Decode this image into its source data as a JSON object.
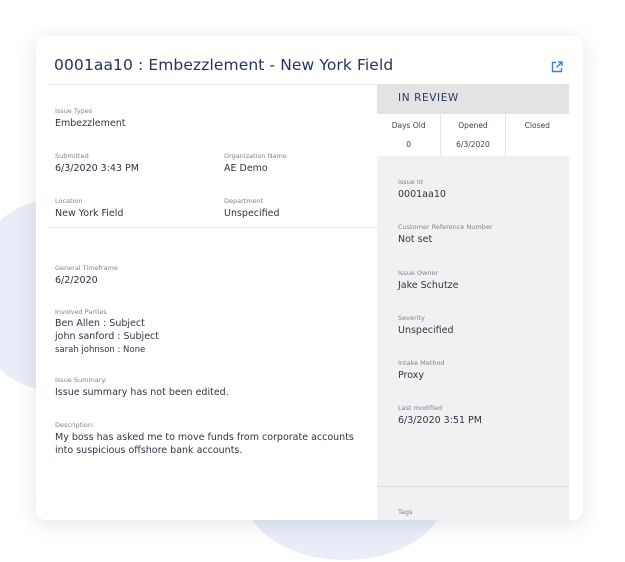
{
  "issue": {
    "title": "0001aa10 : Embezzlement - New York Field"
  },
  "fields": {
    "issue_types": {
      "label": "Issue Types",
      "value": "Embezzlement"
    },
    "submitted": {
      "label": "Submitted",
      "value": "6/3/2020 3:43 PM"
    },
    "organization_name": {
      "label": "Organization Name",
      "value": "AE Demo"
    },
    "location": {
      "label": "Location",
      "value": "New York Field"
    },
    "department": {
      "label": "Department",
      "value": "Unspecified"
    },
    "general_timeframe": {
      "label": "General Timeframe",
      "value": "6/2/2020"
    },
    "involved_parties": {
      "label": "Involved Parties",
      "items": [
        "Ben Allen : Subject",
        "john sanford : Subject",
        "sarah johnson : None"
      ]
    },
    "issue_summary": {
      "label": "Issue Summary:",
      "value": "Issue summary has not been edited."
    },
    "description": {
      "label": "Description:",
      "value": "My boss has asked me to move funds from corporate accounts into suspicious offshore bank accounts."
    }
  },
  "status": {
    "label": "IN REVIEW",
    "stats": [
      {
        "header": "Days Old",
        "value": "0"
      },
      {
        "header": "Opened",
        "value": "6/3/2020"
      },
      {
        "header": "Closed",
        "value": ""
      }
    ]
  },
  "details": {
    "issue_id": {
      "label": "Issue Id",
      "value": "0001aa10"
    },
    "customer_reference": {
      "label": "Customer Reference Number",
      "value": "Not set"
    },
    "issue_owner": {
      "label": "Issue Owner",
      "value": "Jake Schutze"
    },
    "severity": {
      "label": "Severity",
      "value": "Unspecified"
    },
    "intake_method": {
      "label": "Intake Method",
      "value": "Proxy"
    },
    "last_modified": {
      "label": "Last modified",
      "value": "6/3/2020 3:51 PM"
    },
    "tags": {
      "label": "Tags"
    }
  },
  "colors": {
    "title": "#24345e",
    "accent_icon": "#3d7fe0",
    "sidebar_bg": "#f1f1f1",
    "status_bar_bg": "#e3e3e3"
  },
  "icons": {
    "open_external": "external-link-icon"
  }
}
